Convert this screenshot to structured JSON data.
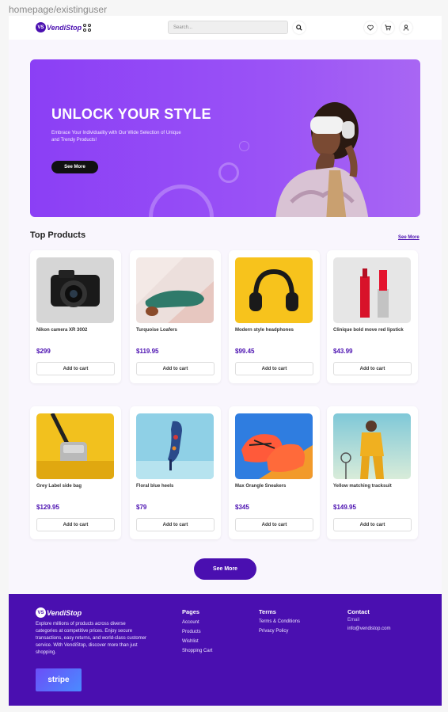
{
  "frame_label": "homepage/existinguser",
  "header": {
    "brand": "VendiStop",
    "brand_badge": "VS",
    "search_placeholder": "Search..."
  },
  "hero": {
    "title": "UNLOCK YOUR STYLE",
    "subtitle": "Embrace Your Individuality with Our Wide Selection of Unique and Trendy Products!",
    "button": "See More"
  },
  "products_section": {
    "title": "Top Products",
    "see_more_link": "See More",
    "add_to_cart_label": "Add to cart",
    "items": [
      {
        "name": "Nikon camera XR 3002",
        "price": "$299"
      },
      {
        "name": "Turquoise Loafers",
        "price": "$119.95"
      },
      {
        "name": "Modern style headphones",
        "price": "$99.45"
      },
      {
        "name": "Clinique bold move red lipstick",
        "price": "$43.99"
      },
      {
        "name": "Grey Label side bag",
        "price": "$129.95"
      },
      {
        "name": "Floral blue heels",
        "price": "$79"
      },
      {
        "name": "Max Orangle Sneakers",
        "price": "$345"
      },
      {
        "name": "Yellow matching tracksuit",
        "price": "$149.95"
      }
    ],
    "see_more_button": "See More"
  },
  "footer": {
    "brand": "VendiStop",
    "about": "Explore millions of products across diverse categories at competitive prices. Enjoy secure transactions, easy returns, and world-class customer service. With VendiStop, discover more than just shopping.",
    "payment": "stripe",
    "pages_title": "Pages",
    "pages": [
      "Account",
      "Products",
      "Wishlist",
      "Shopping Cart"
    ],
    "terms_title": "Terms",
    "terms": [
      "Terms & Conditions",
      "Privacy Policy"
    ],
    "contact_title": "Contact",
    "contact_email_label": "Email",
    "contact_email": "info@vendistop.com"
  },
  "colors": {
    "brand": "#4a0fb0",
    "hero": "#9a52f6"
  },
  "icons": [
    "grid-icon",
    "search-icon",
    "heart-icon",
    "cart-icon",
    "user-icon"
  ]
}
